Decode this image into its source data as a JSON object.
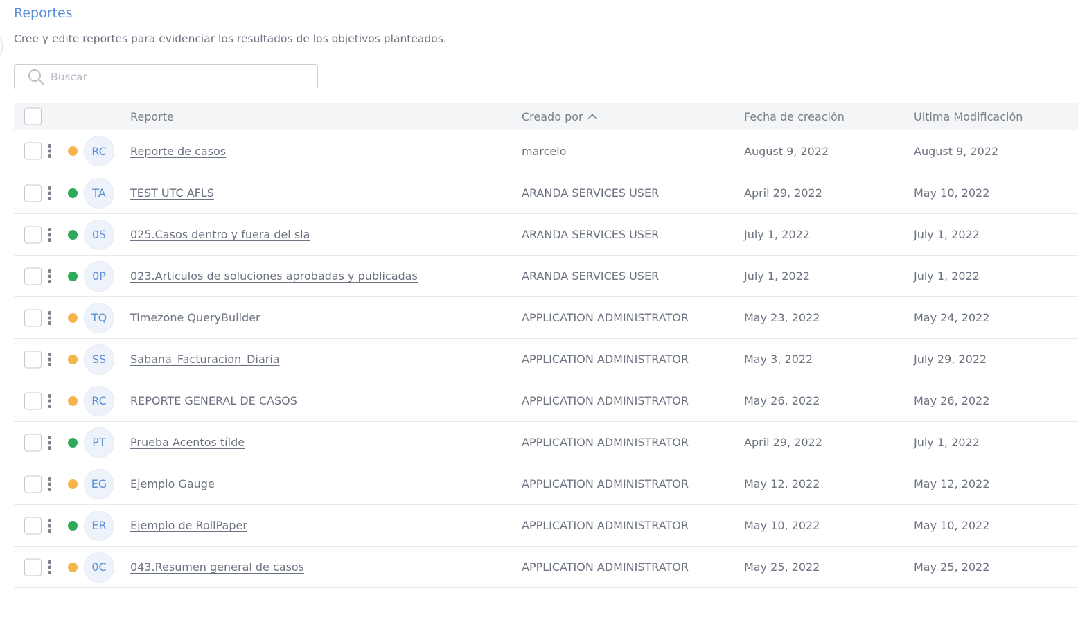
{
  "header": {
    "title": "Reportes",
    "subtitle": "Cree y edite reportes para evidenciar los resultados de los objetivos planteados."
  },
  "search": {
    "placeholder": "Buscar",
    "value": ""
  },
  "table": {
    "columns": {
      "report": "Reporte",
      "created_by": "Creado por",
      "created_date": "Fecha de creación",
      "modified_date": "Ultima Modificación"
    },
    "sort": {
      "column": "created_by",
      "direction": "ascending"
    },
    "status_colors": {
      "orange": "#f5b54a",
      "green": "#2eaa58"
    },
    "rows": [
      {
        "status": "orange",
        "initials": "RC",
        "name": "Reporte de casos",
        "created_by": "marcelo",
        "created": "August 9, 2022",
        "modified": "August 9, 2022"
      },
      {
        "status": "green",
        "initials": "TA",
        "name": "TEST UTC AFLS",
        "created_by": "ARANDA SERVICES USER",
        "created": "April 29, 2022",
        "modified": "May 10, 2022"
      },
      {
        "status": "green",
        "initials": "0S",
        "name": "025.Casos dentro y fuera del sla",
        "created_by": "ARANDA SERVICES USER",
        "created": "July 1, 2022",
        "modified": "July 1, 2022"
      },
      {
        "status": "green",
        "initials": "0P",
        "name": "023.Articulos de soluciones aprobadas y publicadas",
        "created_by": "ARANDA SERVICES USER",
        "created": "July 1, 2022",
        "modified": "July 1, 2022"
      },
      {
        "status": "orange",
        "initials": "TQ",
        "name": "Timezone QueryBuilder",
        "created_by": "APPLICATION ADMINISTRATOR",
        "created": "May 23, 2022",
        "modified": "May 24, 2022"
      },
      {
        "status": "orange",
        "initials": "SS",
        "name": "Sabana_Facturacion_Diaria",
        "created_by": "APPLICATION ADMINISTRATOR",
        "created": "May 3, 2022",
        "modified": "July 29, 2022"
      },
      {
        "status": "orange",
        "initials": "RC",
        "name": "REPORTE GENERAL DE CASOS",
        "created_by": "APPLICATION ADMINISTRATOR",
        "created": "May 26, 2022",
        "modified": "May 26, 2022"
      },
      {
        "status": "green",
        "initials": "PT",
        "name": "Prueba Acentos tílde",
        "created_by": "APPLICATION ADMINISTRATOR",
        "created": "April 29, 2022",
        "modified": "July 1, 2022"
      },
      {
        "status": "orange",
        "initials": "EG",
        "name": "Ejemplo Gauge",
        "created_by": "APPLICATION ADMINISTRATOR",
        "created": "May 12, 2022",
        "modified": "May 12, 2022"
      },
      {
        "status": "green",
        "initials": "ER",
        "name": "Ejemplo de RollPaper",
        "created_by": "APPLICATION ADMINISTRATOR",
        "created": "May 10, 2022",
        "modified": "May 10, 2022"
      },
      {
        "status": "orange",
        "initials": "0C",
        "name": "043.Resumen general de casos",
        "created_by": "APPLICATION ADMINISTRATOR",
        "created": "May 25, 2022",
        "modified": "May 25, 2022"
      }
    ]
  }
}
